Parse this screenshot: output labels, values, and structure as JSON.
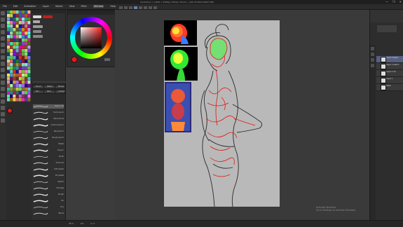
{
  "window": {
    "title": "Illustration 1 (4961 x 3508px 350dpi 36.0%) - CLIP STUDIO PAINT PRO",
    "controls": [
      "—",
      "❐",
      "✕"
    ]
  },
  "menubar": {
    "items": [
      "File",
      "Edit",
      "Animation",
      "Layer",
      "Select",
      "View",
      "Filter",
      "Window",
      "Help"
    ],
    "active": "Window"
  },
  "subtool": {
    "tabs": [
      "Pen",
      "Pencil",
      "Brush"
    ],
    "props": [
      "Brush Size",
      "Opacity",
      "Anti-aliasing",
      "Stabilization"
    ]
  },
  "brush_tabs": [
    "Pencil",
    "Pastel",
    "Marker",
    "Pen",
    "Real",
    "Custom"
  ],
  "brushes": [
    {
      "label": "Sketch 2B",
      "selected": true
    },
    {
      "label": "Dark pencil"
    },
    {
      "label": "Mechanical"
    },
    {
      "label": "Colored pencil"
    },
    {
      "label": "Real pencil"
    },
    {
      "label": "Rough pencil"
    },
    {
      "label": "Pastel"
    },
    {
      "label": "Crayon"
    },
    {
      "label": "Chalk"
    },
    {
      "label": "Charcoal"
    },
    {
      "label": "Soft pastel"
    },
    {
      "label": "Oil pastel"
    },
    {
      "label": "Sketch"
    },
    {
      "label": "Smudge"
    },
    {
      "label": "Rough"
    },
    {
      "label": "Ink"
    },
    {
      "label": "Dry"
    },
    {
      "label": "Blend"
    }
  ],
  "colors": {
    "main": "#e31b1b",
    "accent_panel": "#566080"
  },
  "layers": [
    {
      "name": "Layer 4 Paper",
      "selected": true
    },
    {
      "name": "Layer 3 sketch"
    },
    {
      "name": "Layer 2 ref"
    },
    {
      "name": "Layer 1"
    },
    {
      "name": "Paper"
    }
  ],
  "status": {
    "zoom": "36.0",
    "angle": "0.0",
    "coords": "0, 0"
  },
  "watermark": {
    "line1": "Activate Windows",
    "line2": "Go to Settings to activate Windows."
  }
}
